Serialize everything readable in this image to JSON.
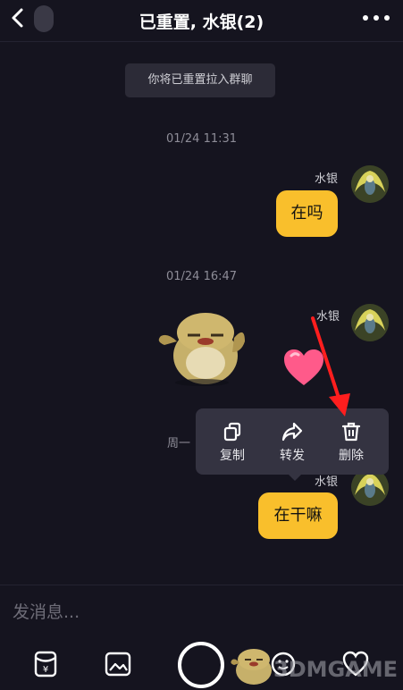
{
  "header": {
    "title": "已重置, 水银(2)"
  },
  "system_notice": "你将已重置拉入群聊",
  "messages": [
    {
      "timestamp": "01/24 11:31",
      "sender": "水银",
      "text": "在吗"
    },
    {
      "timestamp": "01/24 16:47",
      "sender": "水银",
      "text": ""
    },
    {
      "timestamp": "周一",
      "sender": "水银",
      "text": "在干嘛"
    }
  ],
  "context_menu": {
    "items": [
      {
        "label": "复制",
        "icon": "copy-icon"
      },
      {
        "label": "转发",
        "icon": "forward-icon"
      },
      {
        "label": "删除",
        "icon": "trash-icon"
      }
    ]
  },
  "input": {
    "placeholder": "发消息..."
  },
  "watermark": "3DMGAME",
  "colors": {
    "background": "#15141f",
    "bubble": "#f9bf2c",
    "menu": "#343341",
    "arrow": "#ff1e1e",
    "heart": "#ff5a8a"
  }
}
